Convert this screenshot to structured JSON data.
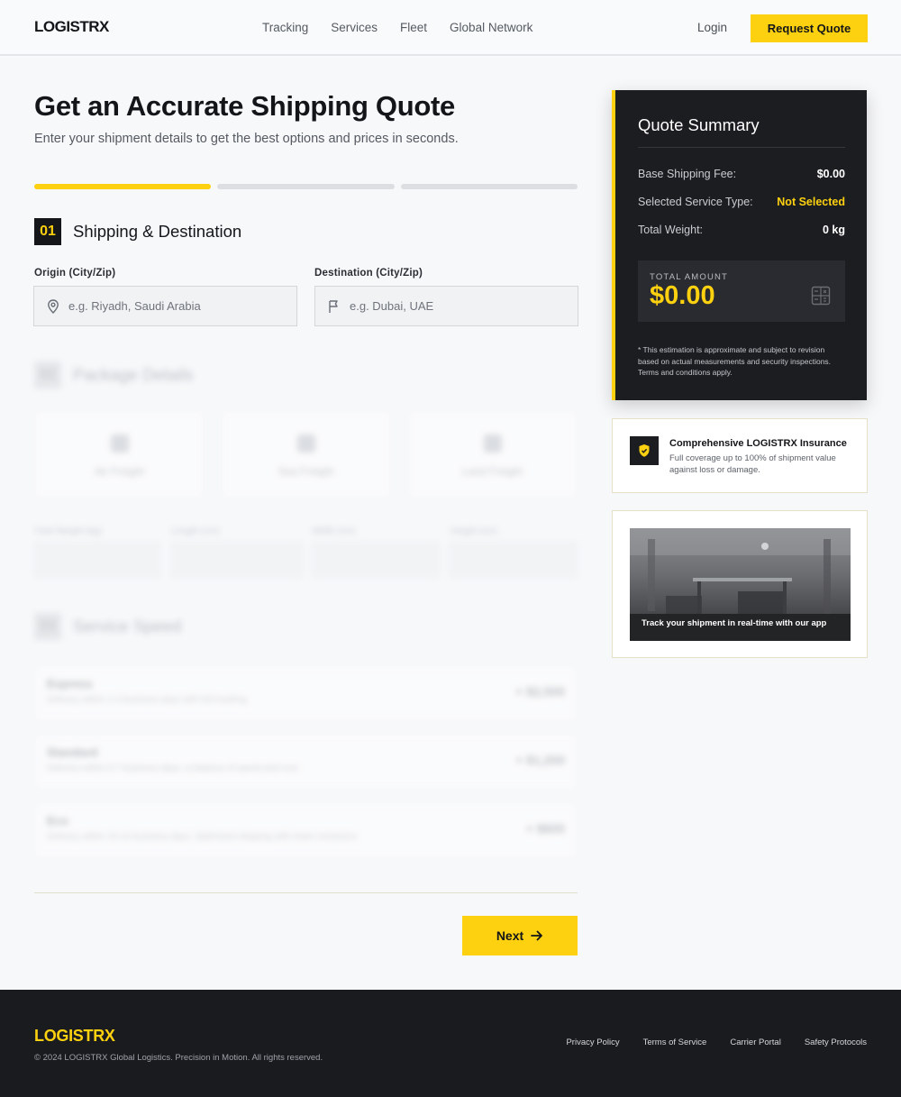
{
  "header": {
    "logo": "LOGISTRX",
    "nav": [
      "Tracking",
      "Services",
      "Fleet",
      "Global Network"
    ],
    "login": "Login",
    "cta": "Request Quote"
  },
  "main": {
    "title": "Get an Accurate Shipping Quote",
    "subtitle": "Enter your shipment details to get the best options and prices in seconds.",
    "progress": {
      "steps": 3,
      "current": 1
    },
    "step1": {
      "number": "01",
      "title": "Shipping & Destination",
      "origin_label": "Origin (City/Zip)",
      "origin_placeholder": "e.g. Riyadh, Saudi Arabia",
      "destination_label": "Destination (City/Zip)",
      "destination_placeholder": "e.g. Dubai, UAE"
    },
    "step2": {
      "number": "02",
      "title": "Package Details",
      "freight_options": [
        "Air Freight",
        "Sea Freight",
        "Land Freight"
      ],
      "dimension_labels": [
        "Total Weight (kg)",
        "Length (cm)",
        "Width (cm)",
        "Height (cm)"
      ]
    },
    "step3": {
      "number": "03",
      "title": "Service Speed",
      "options": [
        {
          "name": "Express",
          "desc": "Delivery within 1-3 business days with full tracking",
          "price": "+ $2,500"
        },
        {
          "name": "Standard",
          "desc": "Delivery within 5-7 business days, a balance of speed and cost",
          "price": "+ $1,200"
        },
        {
          "name": "Eco",
          "desc": "Delivery within 10-14 business days. Optimized shipping with lower emissions",
          "price": "+ $600"
        }
      ]
    },
    "next": "Next"
  },
  "summary": {
    "title": "Quote Summary",
    "rows": [
      {
        "label": "Base Shipping Fee:",
        "value": "$0.00"
      },
      {
        "label": "Selected Service Type:",
        "value": "Not Selected"
      },
      {
        "label": "Total Weight:",
        "value": "0 kg"
      }
    ],
    "total_label": "TOTAL AMOUNT",
    "total_amount": "$0.00",
    "note": "* This estimation is approximate and subject to revision based on actual measurements and security inspections. Terms and conditions apply."
  },
  "insurance": {
    "title": "Comprehensive LOGISTRX Insurance",
    "desc": "Full coverage up to 100% of shipment value against loss or damage."
  },
  "app_promo": {
    "caption": "Track your shipment in real-time with our app"
  },
  "footer": {
    "logo": "LOGISTRX",
    "copyright": "© 2024 LOGISTRX Global Logistics. Precision in Motion. All rights reserved.",
    "links": [
      "Privacy Policy",
      "Terms of Service",
      "Carrier Portal",
      "Safety Protocols"
    ]
  },
  "colors": {
    "accent": "#fdd10f",
    "dark": "#1c1d21"
  }
}
